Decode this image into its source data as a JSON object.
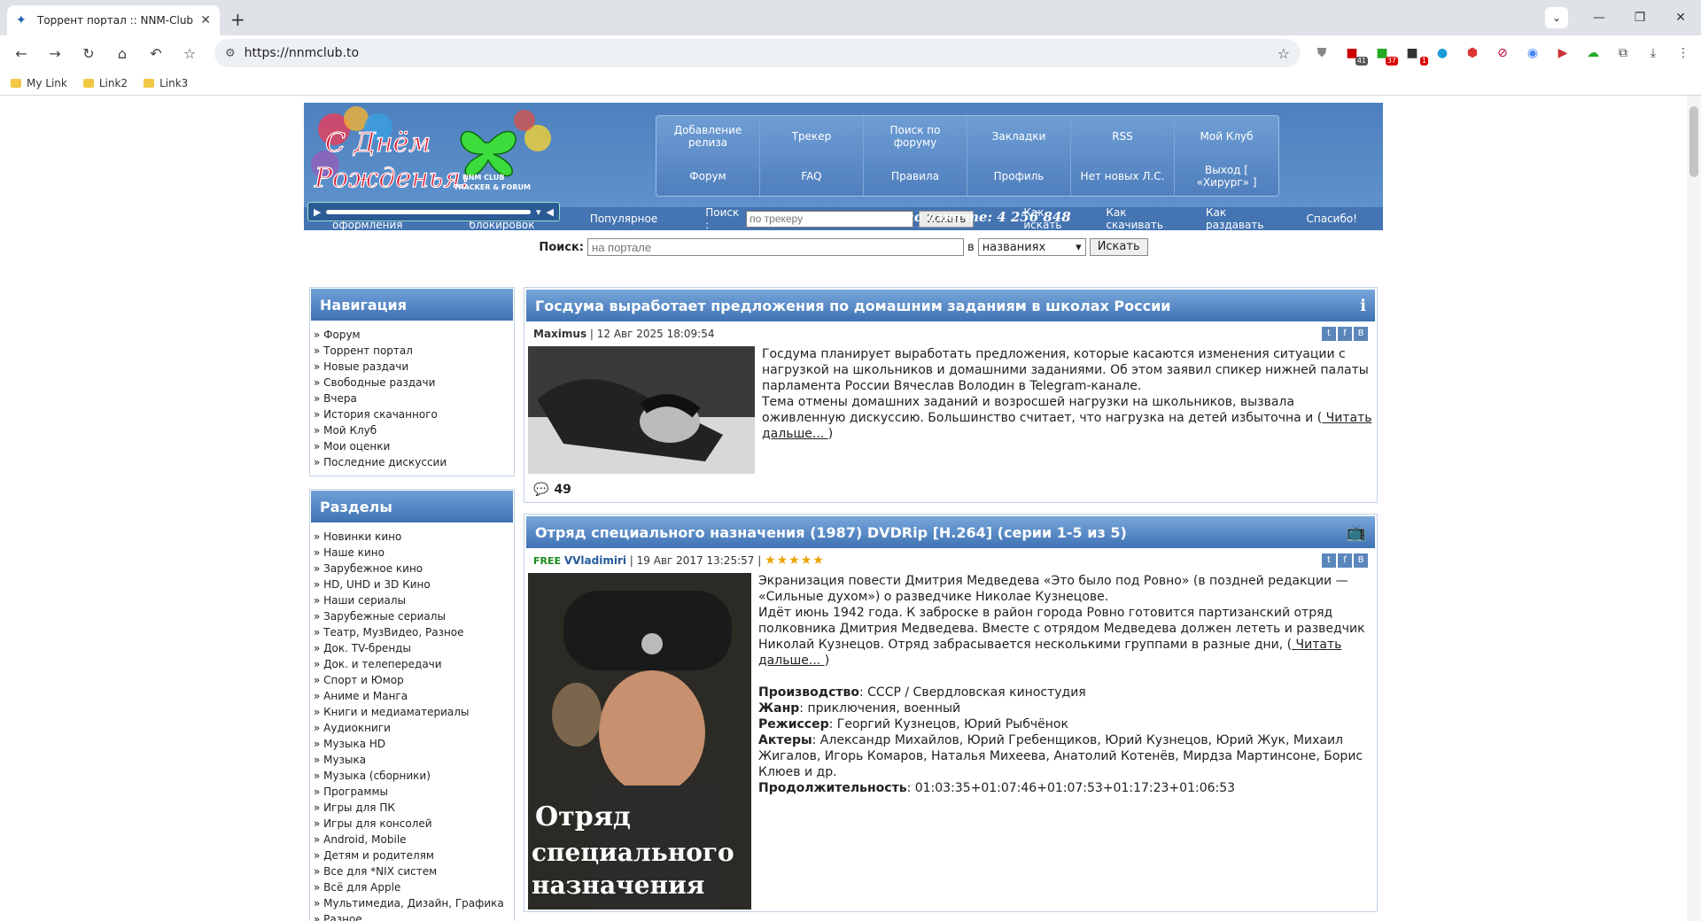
{
  "browser": {
    "tab_title": "Торрент портал :: NNM-Club",
    "url": "https://nnmclub.to",
    "bookmarks": [
      "My Link",
      "Link2",
      "Link3"
    ],
    "ext_badges": [
      "41",
      "37",
      "1"
    ]
  },
  "site": {
    "topnav_row1": [
      "Добавление релиза",
      "Трекер",
      "Поиск по форуму",
      "Закладки",
      "RSS",
      "Мой Клуб"
    ],
    "topnav_row2": [
      "Форум",
      "FAQ",
      "Правила",
      "Профиль",
      "Нет новых Л.С.",
      "Выход [ «Хирург» ]"
    ],
    "together": "Нас вместе: 4 256 848",
    "logo_text": "NNM CLUB TRACKER & FORUM",
    "subnav": {
      "rules": "Правила оформления",
      "bypass": "Обход блокировок",
      "popular": "Популярное",
      "search_label": "Поиск :",
      "search_placeholder": "по трекеру",
      "search_btn": "Искать",
      "how_search": "Как искать",
      "how_download": "Как скачивать",
      "how_seed": "Как раздавать",
      "thanks": "Спасибо!"
    },
    "portal_search": {
      "label": "Поиск:",
      "placeholder": "на портале",
      "in": "в",
      "select": "названиях",
      "btn": "Искать"
    }
  },
  "nav": {
    "title": "Навигация",
    "items": [
      "Форум",
      "Торрент портал",
      "Новые раздачи",
      "Свободные раздачи",
      "Вчера",
      "История скачанного",
      "Мой Клуб",
      "Мои оценки",
      "Последние дискуссии"
    ]
  },
  "sections": {
    "title": "Разделы",
    "items": [
      "Новинки кино",
      "Наше кино",
      "Зарубежное кино",
      "HD, UHD и 3D Кино",
      "Наши сериалы",
      "Зарубежные сериалы",
      "Театр, МузВидео, Разное",
      "Док. TV-бренды",
      "Док. и телепередачи",
      "Спорт и Юмор",
      "Аниме и Манга",
      "Книги и медиаматериалы",
      "Аудиокниги",
      "Музыка HD",
      "Музыка",
      "Музыка (сборники)",
      "Программы",
      "Игры для ПК",
      "Игры для консолей",
      "Android, Mobile",
      "Детям и родителям",
      "Все для *NIX систем",
      "Всё для Apple",
      "Мультимедиа, Дизайн, Графика",
      "Разное"
    ]
  },
  "posts": [
    {
      "title": "Госдума выработает предложения по домашним заданиям в школах России",
      "author": "Maximus",
      "date": "12 Авг 2025 18:09:54",
      "text": "Госдума планирует выработать предложения, которые касаются изменения ситуации с нагрузкой на школьников и домашними заданиями. Об этом заявил спикер нижней палаты парламента России Вячеслав Володин в Telegram-канале.",
      "text2": "Тема отмены домашних заданий и возросшей нагрузки на школьников, вызвала оживленную дискуссию. Большинство считает, что нагрузка на детей избыточна и (",
      "readmore": " Читать дальше... ",
      "readmore_close": ")",
      "comments": "49"
    },
    {
      "title": "Отряд специального назначения (1987) DVDRip [H.264] (серии 1-5 из 5)",
      "free": "FREE",
      "author": "VVladimiri",
      "date": "19 Авг 2017 13:25:57",
      "stars": "★★★★★",
      "text": "Экранизация повести Дмитрия Медведева «Это было под Ровно» (в поздней редакции — «Сильные духом») о разведчике Николае Кузнецове.",
      "text2": "Идёт июнь 1942 года. К заброске в район города Ровно готовится партизанский отряд полковника Дмитрия Медведева. Вместе с отрядом Медведева должен лететь и разведчик Николай Кузнецов. Отряд забрасывается несколькими группами в разные дни, (",
      "readmore": " Читать дальше... ",
      "readmore_close": ")",
      "production_label": "Производство",
      "production": ": СССР / Свердловская киностудия",
      "genre_label": "Жанр",
      "genre": ": приключения, военный",
      "director_label": "Режиссер",
      "director": ": Георгий Кузнецов, Юрий Рыбчёнок",
      "actors_label": "Актеры",
      "actors": ": Александр Михайлов, Юрий Гребенщиков, Юрий Кузнецов, Юрий Жук, Михаил Жигалов, Игорь Комаров, Наталья Михеева, Анатолий Котенёв, Мирдза Мартинсоне, Борис Клюев и др.",
      "duration_label": "Продолжительность",
      "duration": ": 01:03:35+01:07:46+01:07:53+01:17:23+01:06:53",
      "poster_text": "Отряд специального назначения"
    }
  ]
}
